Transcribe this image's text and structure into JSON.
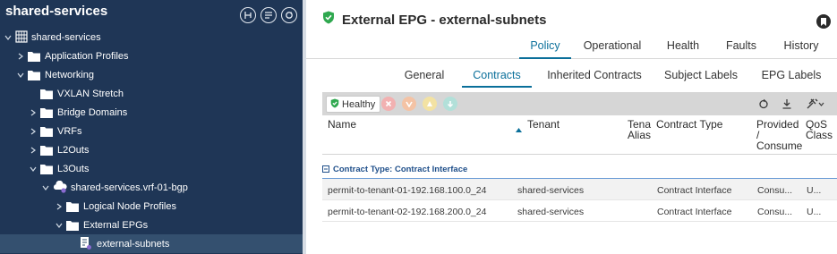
{
  "sidebar": {
    "title": "shared-services",
    "header_icons": [
      "filter-icon",
      "list-icon",
      "refresh-icon"
    ],
    "tree": [
      {
        "label": "shared-services",
        "icon": "tenant-icon",
        "depth": 0,
        "expanded": true
      },
      {
        "label": "Application Profiles",
        "icon": "folder-icon",
        "depth": 1,
        "expanded": false
      },
      {
        "label": "Networking",
        "icon": "folder-icon",
        "depth": 1,
        "expanded": true
      },
      {
        "label": "VXLAN Stretch",
        "icon": "folder-icon",
        "depth": 2,
        "expanded": null
      },
      {
        "label": "Bridge Domains",
        "icon": "folder-icon",
        "depth": 2,
        "expanded": false
      },
      {
        "label": "VRFs",
        "icon": "folder-icon",
        "depth": 2,
        "expanded": false
      },
      {
        "label": "L2Outs",
        "icon": "folder-icon",
        "depth": 2,
        "expanded": false
      },
      {
        "label": "L3Outs",
        "icon": "folder-icon",
        "depth": 2,
        "expanded": true
      },
      {
        "label": "shared-services.vrf-01-bgp",
        "icon": "l3out-cloud-icon",
        "depth": 3,
        "expanded": true
      },
      {
        "label": "Logical Node Profiles",
        "icon": "folder-icon",
        "depth": 4,
        "expanded": false
      },
      {
        "label": "External EPGs",
        "icon": "folder-icon",
        "depth": 4,
        "expanded": true
      },
      {
        "label": "external-subnets",
        "icon": "epg-icon",
        "depth": 5,
        "expanded": null,
        "selected": true
      }
    ]
  },
  "main": {
    "title": "External EPG - external-subnets",
    "title_icon": "shield-check-icon",
    "bookmark_icon": "bookmark-icon",
    "tabs": [
      {
        "label": "Policy",
        "active": true
      },
      {
        "label": "Operational",
        "active": false
      },
      {
        "label": "Health",
        "active": false
      },
      {
        "label": "Faults",
        "active": false
      },
      {
        "label": "History",
        "active": false
      }
    ],
    "subtabs": [
      {
        "label": "General",
        "active": false
      },
      {
        "label": "Contracts",
        "active": true
      },
      {
        "label": "Inherited Contracts",
        "active": false
      },
      {
        "label": "Subject Labels",
        "active": false
      },
      {
        "label": "EPG Labels",
        "active": false
      }
    ],
    "toolbar": {
      "health_label": "Healthy",
      "fault_icons": [
        {
          "name": "critical-fault-icon",
          "color": "#f2b1b1"
        },
        {
          "name": "major-fault-icon",
          "color": "#f4c3a5"
        },
        {
          "name": "minor-fault-icon",
          "color": "#f3e2a3"
        },
        {
          "name": "warning-fault-icon",
          "color": "#b2e0d9"
        }
      ],
      "right_icons": [
        "refresh-icon",
        "download-icon",
        "tools-icon"
      ]
    },
    "table": {
      "columns": [
        "Name",
        "Tenant",
        "Tena\nAlias",
        "Contract Type",
        "Provided\n/\nConsume",
        "QoS\nClass"
      ],
      "group_label": "Contract Type: Contract Interface",
      "rows": [
        [
          "permit-to-tenant-01-192.168.100.0_24",
          "shared-services",
          "",
          "Contract Interface",
          "Consu...",
          "U..."
        ],
        [
          "permit-to-tenant-02-192.168.200.0_24",
          "shared-services",
          "",
          "Contract Interface",
          "Consu...",
          "U..."
        ]
      ]
    }
  },
  "colors": {
    "sidebar_bg": "#1f3656",
    "accent": "#0a6f9a",
    "healthy_green": "#2fa84f"
  }
}
